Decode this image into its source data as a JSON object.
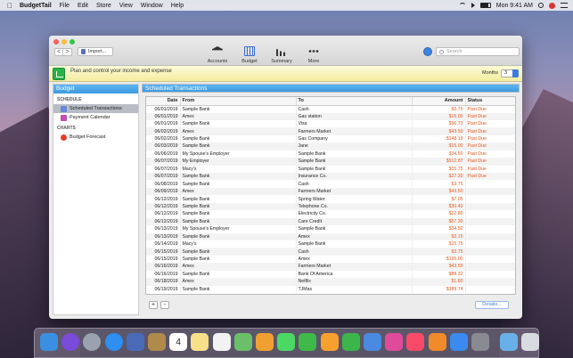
{
  "menubar": {
    "app_name": "BudgetTail",
    "items": [
      "File",
      "Edit",
      "Store",
      "View",
      "Window",
      "Help"
    ],
    "clock": "Mon 9:41 AM"
  },
  "window": {
    "nav_back": "<",
    "nav_forward": ">",
    "import_label": "Import...",
    "toolbar": [
      {
        "label": "Accounts",
        "icon": "bank-icon"
      },
      {
        "label": "Budget",
        "icon": "calendar-icon"
      },
      {
        "label": "Summary",
        "icon": "bar-chart-icon"
      },
      {
        "label": "More",
        "icon": "more-dots-icon"
      }
    ],
    "search_placeholder": "Search",
    "tagline": "Plan and control your income and expense",
    "months_label": "Months",
    "months_value": "3"
  },
  "sidebar": {
    "header": "Budget",
    "sections": [
      {
        "title": "SCHEDULE",
        "items": [
          {
            "label": "Scheduled Transactions",
            "selected": true,
            "icon": "scheduled-icon"
          },
          {
            "label": "Payment Calendar",
            "selected": false,
            "icon": "calendar-icon"
          }
        ]
      },
      {
        "title": "CHARTS",
        "items": [
          {
            "label": "Budget Forecast",
            "selected": false,
            "icon": "pie-chart-icon"
          }
        ]
      }
    ]
  },
  "main": {
    "title": "Scheduled Transactions",
    "columns": [
      "Date",
      "From",
      "To",
      "Amount",
      "Status"
    ],
    "rows": [
      [
        "06/01/2019",
        "Sample Bank",
        "Cash",
        "$3.75",
        "Past Due"
      ],
      [
        "06/01/2019",
        "Amex",
        "Gas station",
        "$15.00",
        "Past Due"
      ],
      [
        "06/01/2019",
        "Sample Bank",
        "Visa",
        "$56.70",
        "Past Due"
      ],
      [
        "06/02/2019",
        "Amex",
        "Farmers Market",
        "$43.50",
        "Past Due"
      ],
      [
        "06/02/2019",
        "Sample Bank",
        "Gas Company",
        "$148.19",
        "Past Due"
      ],
      [
        "06/03/2019",
        "Sample Bank",
        "Jane",
        "$15.00",
        "Past Due"
      ],
      [
        "06/06/2019",
        "My Spouse's Employer",
        "Sample Bank",
        "$34.50",
        "Past Due"
      ],
      [
        "06/07/2019",
        "My Employer",
        "Sample Bank",
        "$512.87",
        "Past Due"
      ],
      [
        "06/07/2019",
        "Macy's",
        "Sample Bank",
        "$15.75",
        "Past Due"
      ],
      [
        "06/07/2019",
        "Sample Bank",
        "Insurance Co.",
        "$27.30",
        "Past Due"
      ],
      [
        "06/08/2019",
        "Sample Bank",
        "Cash",
        "$3.75",
        ""
      ],
      [
        "06/09/2019",
        "Amex",
        "Farmers Market",
        "$43.50",
        ""
      ],
      [
        "06/12/2019",
        "Sample Bank",
        "Spring Water",
        "$7.05",
        ""
      ],
      [
        "06/12/2019",
        "Sample Bank",
        "Telephone Co.",
        "$30.40",
        ""
      ],
      [
        "06/12/2019",
        "Sample Bank",
        "Electricity Co.",
        "$22.80",
        ""
      ],
      [
        "06/12/2019",
        "Sample Bank",
        "Care Credit",
        "$57.30",
        ""
      ],
      [
        "06/13/2019",
        "My Spouse's Employer",
        "Sample Bank",
        "$34.50",
        ""
      ],
      [
        "06/13/2019",
        "Sample Bank",
        "Amex",
        "$3.15",
        ""
      ],
      [
        "06/14/2019",
        "Macy's",
        "Sample Bank",
        "$15.75",
        ""
      ],
      [
        "06/15/2019",
        "Sample Bank",
        "Cash",
        "$3.75",
        ""
      ],
      [
        "06/15/2019",
        "Sample Bank",
        "Amex",
        "$195.00",
        ""
      ],
      [
        "06/16/2019",
        "Amex",
        "Farmers Market",
        "$43.50",
        ""
      ],
      [
        "06/16/2019",
        "Sample Bank",
        "Bank Of America",
        "$88.32",
        ""
      ],
      [
        "06/18/2019",
        "Amex",
        "Netflix",
        "$1.80",
        ""
      ],
      [
        "06/19/2019",
        "Sample Bank",
        "TJMax",
        "$389.74",
        ""
      ]
    ],
    "add_label": "+",
    "remove_label": "-",
    "details_label": "Details..."
  },
  "dock": {
    "apps": [
      "finder-icon",
      "siri-icon",
      "launchpad-icon",
      "safari-icon",
      "photo-slideshow-icon",
      "notebook-icon",
      "calendar-icon",
      "notes-icon",
      "reminders-icon",
      "maps-icon",
      "photos-icon",
      "messages-icon",
      "facetime-icon",
      "pages-icon",
      "numbers-icon",
      "keynote-icon",
      "budgettail-icon",
      "music-icon",
      "books-icon",
      "app-store-icon",
      "system-preferences-icon",
      "downloads-folder-icon",
      "trash-icon"
    ]
  },
  "dock_date": "4"
}
